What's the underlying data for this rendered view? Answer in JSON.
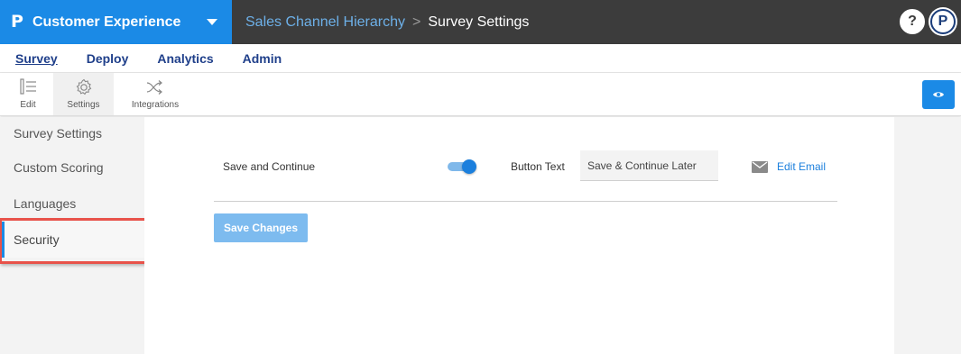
{
  "header": {
    "logo_glyph": "P",
    "app_name": "Customer Experience",
    "breadcrumb": [
      "Sales Channel Hierarchy",
      "Survey Settings"
    ],
    "breadcrumb_separator": ">",
    "help_glyph": "?",
    "profile_glyph": "P",
    "colors": {
      "brand_blue": "#1b8ae6",
      "topbar_dark": "#3c3c3c"
    }
  },
  "nav": {
    "tabs": [
      {
        "label": "Survey",
        "active": true
      },
      {
        "label": "Deploy",
        "active": false
      },
      {
        "label": "Analytics",
        "active": false
      },
      {
        "label": "Admin",
        "active": false
      }
    ]
  },
  "toolbar": {
    "items": [
      {
        "label": "Edit",
        "icon": "edit-list-icon"
      },
      {
        "label": "Settings",
        "icon": "gear-icon",
        "active": true
      },
      {
        "label": "Integrations",
        "icon": "shuffle-icon"
      }
    ],
    "preview_icon": "eye-icon"
  },
  "sidebar": {
    "items": [
      {
        "label": "Survey Settings"
      },
      {
        "label": "Custom Scoring"
      },
      {
        "label": "Languages"
      },
      {
        "label": "Security",
        "active": true
      }
    ]
  },
  "settings": {
    "row_label": "Save and Continue",
    "toggle_on": true,
    "button_text_label": "Button Text",
    "button_text_value": "Save & Continue Later",
    "edit_email_label": "Edit Email",
    "save_button_label": "Save Changes"
  }
}
